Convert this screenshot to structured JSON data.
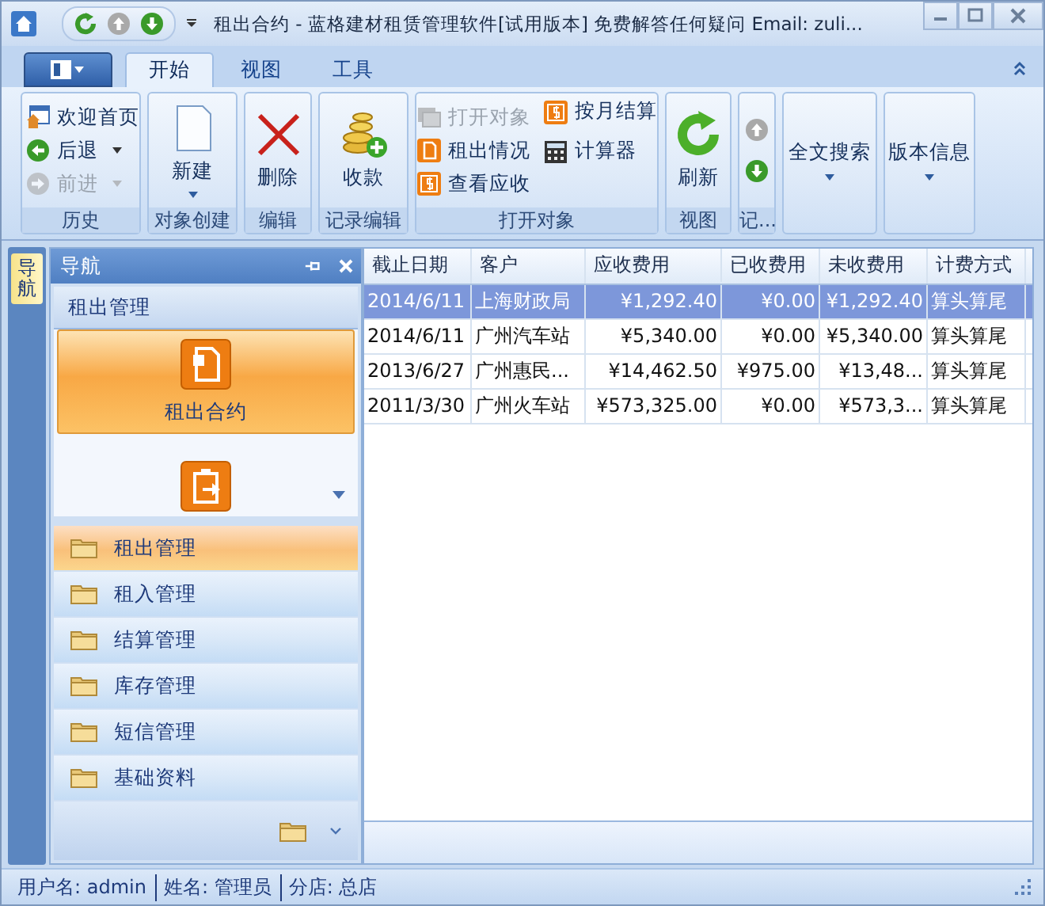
{
  "window": {
    "title": "租出合约 - 蓝格建材租赁管理软件[试用版本] 免费解答任何疑问 Email: zuli..."
  },
  "quick_access": [
    {
      "disabled": false
    },
    {
      "disabled": true
    },
    {
      "disabled": false
    }
  ],
  "ribbon": {
    "tabs": [
      {
        "label": "开始",
        "selected": true
      },
      {
        "label": "视图",
        "selected": false
      },
      {
        "label": "工具",
        "selected": false
      }
    ],
    "groups": [
      {
        "caption": "历史",
        "items": [
          {
            "label": "欢迎首页",
            "disabled": false
          },
          {
            "label": "后退",
            "disabled": false
          },
          {
            "label": "前进",
            "disabled": true
          }
        ]
      },
      {
        "caption": "对象创建",
        "items": [
          {
            "label": "新建",
            "disabled": false
          }
        ]
      },
      {
        "caption": "编辑",
        "items": [
          {
            "label": "删除",
            "disabled": false
          }
        ]
      },
      {
        "caption": "记录编辑",
        "items": [
          {
            "label": "收款",
            "disabled": false
          }
        ]
      },
      {
        "caption": "打开对象",
        "items": [
          {
            "label": "打开对象",
            "disabled": true
          },
          {
            "label": "租出情况",
            "disabled": false
          },
          {
            "label": "查看应收",
            "disabled": false
          },
          {
            "label": "按月结算",
            "disabled": false
          },
          {
            "label": "计算器",
            "disabled": false
          }
        ]
      },
      {
        "caption": "视图",
        "items": [
          {
            "label": "刷新",
            "disabled": false
          }
        ]
      },
      {
        "caption": "记...",
        "items": [
          {
            "disabled": true
          },
          {
            "disabled": false
          }
        ]
      },
      {
        "items": [
          {
            "label": "全文搜索",
            "disabled": false
          }
        ]
      },
      {
        "items": [
          {
            "label": "版本信息",
            "disabled": false
          }
        ]
      }
    ]
  },
  "side_tab": {
    "label": "导航"
  },
  "navigation": {
    "title": "导航",
    "section": "租出管理",
    "large_items": [
      {
        "label": "租出合约",
        "selected": true
      },
      {
        "selected": false
      }
    ],
    "categories": [
      {
        "label": "租出管理",
        "selected": true
      },
      {
        "label": "租入管理",
        "selected": false
      },
      {
        "label": "结算管理",
        "selected": false
      },
      {
        "label": "库存管理",
        "selected": false
      },
      {
        "label": "短信管理",
        "selected": false
      },
      {
        "label": "基础资料",
        "selected": false
      }
    ]
  },
  "table": {
    "columns": [
      "截止日期",
      "客户",
      "应收费用",
      "已收费用",
      "未收费用",
      "计费方式"
    ],
    "rows": [
      {
        "selected": true,
        "cells": [
          "2014/6/11",
          "上海财政局",
          "¥1,292.40",
          "¥0.00",
          "¥1,292.40",
          "算头算尾"
        ]
      },
      {
        "selected": false,
        "cells": [
          "2014/6/11",
          "广州汽车站",
          "¥5,340.00",
          "¥0.00",
          "¥5,340.00",
          "算头算尾"
        ]
      },
      {
        "selected": false,
        "cells": [
          "2013/6/27",
          "广州惠民...",
          "¥14,462.50",
          "¥975.00",
          "¥13,48...",
          "算头算尾"
        ]
      },
      {
        "selected": false,
        "cells": [
          "2011/3/30",
          "广州火车站",
          "¥573,325.00",
          "¥0.00",
          "¥573,3...",
          "算头算尾"
        ]
      }
    ]
  },
  "status_bar": [
    "用户名: admin",
    "姓名: 管理员",
    "分店: 总店"
  ]
}
